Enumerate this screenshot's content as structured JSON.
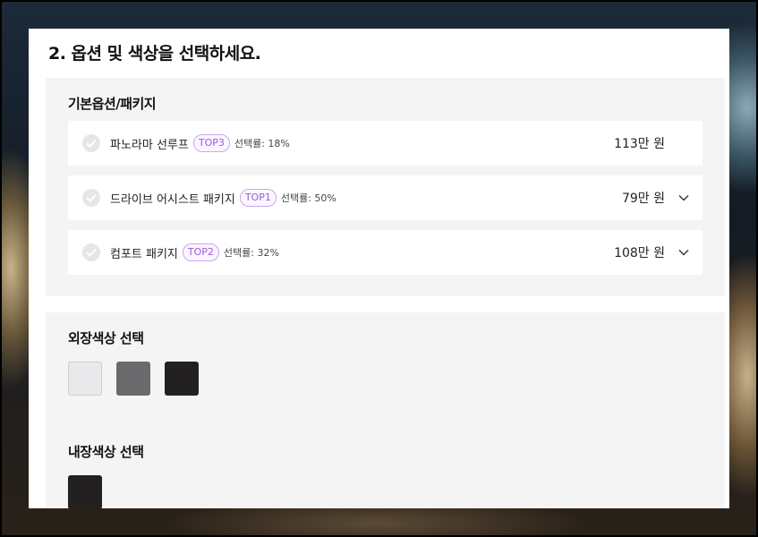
{
  "section": {
    "title": "2. 옵션 및 색상을 선택하세요."
  },
  "basic_options": {
    "title": "기본옵션/패키지",
    "items": [
      {
        "name": "파노라마 선루프",
        "badge": "TOP3",
        "rate": "선택률: 18%",
        "price": "113만 원",
        "expandable": false,
        "selected": false
      },
      {
        "name": "드라이브 어시스트 패키지",
        "badge": "TOP1",
        "rate": "선택률: 50%",
        "price": "79만 원",
        "expandable": true,
        "selected": false
      },
      {
        "name": "컴포트 패키지",
        "badge": "TOP2",
        "rate": "선택률: 32%",
        "price": "108만 원",
        "expandable": true,
        "selected": false
      }
    ]
  },
  "exterior": {
    "title": "외장색상 선택",
    "colors": [
      "#e9e9ec",
      "#6a6a6c",
      "#232021"
    ]
  },
  "interior": {
    "title": "내장색상 선택",
    "colors": [
      "#232021"
    ]
  },
  "icons": {
    "check": "check-icon",
    "expand": "chevron-down-icon"
  }
}
